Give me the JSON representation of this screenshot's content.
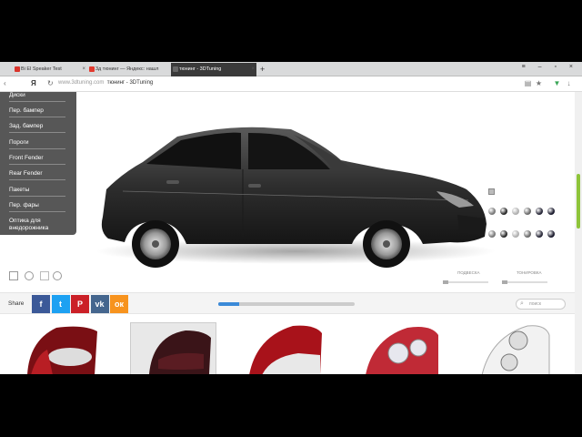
{
  "browser": {
    "tabs": [
      {
        "label": "Bi El Speaker Test",
        "active": false,
        "fav_color": "#d9342b"
      },
      {
        "label": "3д тюнинг — Яндекс: нашл",
        "active": false,
        "fav_color": "#e23a2e"
      },
      {
        "label": "тюнинг - 3DTuning",
        "active": true,
        "fav_color": "#444444"
      }
    ],
    "new_tab": "+",
    "url_host": "www.3dtuning.com",
    "url_title": "тюнинг - 3DTuning",
    "window_controls": "≡ – ▫ ×"
  },
  "menu": {
    "items": [
      "Диски",
      "Пер. бампер",
      "Зад. бампер",
      "Пороги",
      "Front Fender",
      "Rear Fender",
      "Пакеты",
      "Пер. фары",
      "Оптика для внедорожника"
    ]
  },
  "car": {
    "body_color": "#2f2f2f"
  },
  "paint": {
    "row1": [
      "#7a7a7a",
      "#2c2c2c",
      "#b0b0b0",
      "#6c6c6c",
      "#2a2a3a",
      "#1c1c2e"
    ],
    "row2": [
      "#7a7a7a",
      "#2c2c2c",
      "#b0b0b0",
      "#6c6c6c",
      "#2a2a3a",
      "#1c1c2e"
    ]
  },
  "sliders": {
    "suspension_label": "ПОДВЕСКА",
    "tint_label": "ТОНИРОВКА"
  },
  "share": {
    "label": "Share",
    "buttons": [
      {
        "glyph": "f",
        "color": "#3b5998"
      },
      {
        "glyph": "t",
        "color": "#1da1f2"
      },
      {
        "glyph": "P",
        "color": "#cb2027"
      },
      {
        "glyph": "vk",
        "color": "#45668e"
      },
      {
        "glyph": "ок",
        "color": "#f7931e"
      }
    ],
    "progress": 0.15,
    "search_placeholder": "поиск"
  },
  "parts": {
    "count": 5,
    "selected_index": 1
  }
}
